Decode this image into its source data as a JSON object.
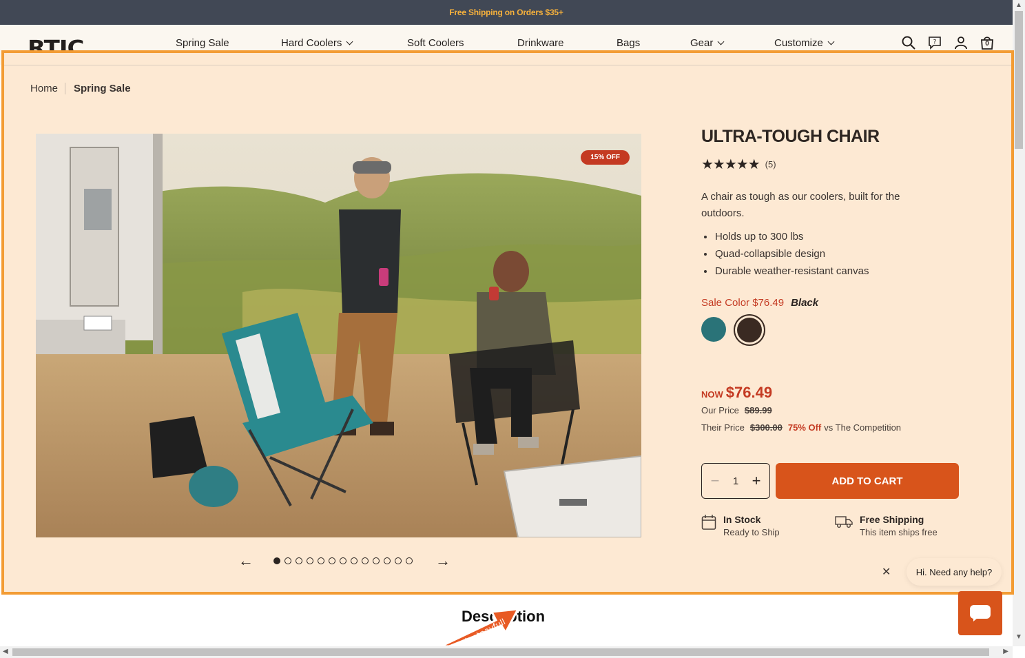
{
  "promo": {
    "text": "Free Shipping on Orders $35+"
  },
  "header": {
    "logo": "RTIC",
    "nav": [
      {
        "label": "Spring Sale",
        "dropdown": false
      },
      {
        "label": "Hard Coolers",
        "dropdown": true
      },
      {
        "label": "Soft Coolers",
        "dropdown": false
      },
      {
        "label": "Drinkware",
        "dropdown": false
      },
      {
        "label": "Bags",
        "dropdown": false
      },
      {
        "label": "Gear",
        "dropdown": true
      },
      {
        "label": "Customize",
        "dropdown": true
      }
    ],
    "icons": [
      "search-icon",
      "help-chat-icon",
      "account-icon",
      "cart-icon"
    ],
    "cart_count": "0"
  },
  "breadcrumb": {
    "home": "Home",
    "current": "Spring Sale"
  },
  "product": {
    "badge": "15% OFF",
    "title": "ULTRA-TOUGH CHAIR",
    "stars": "★★★★★",
    "rating_count": "(5)",
    "rating_value": 5,
    "description": "A chair as tough as our coolers, built for the outdoors.",
    "features": [
      "Holds up to 300 lbs",
      "Quad-collapsible design",
      "Durable weather-resistant canvas"
    ],
    "sale_color_label": "Sale Color $76.49",
    "selected_color": "Black",
    "swatches": [
      {
        "name": "Teal",
        "color": "#2a7378"
      },
      {
        "name": "Black",
        "color": "#3a2a22",
        "selected": true
      }
    ],
    "now_label": "NOW",
    "now_price": "$76.49",
    "our_price_label": "Our Price",
    "our_price": "$89.99",
    "their_price_label": "Their Price",
    "their_price": "$300.00",
    "pct_off": "75% Off",
    "competition_label": "vs The Competition",
    "quantity": "1",
    "add_to_cart": "ADD TO CART",
    "stock_title": "In Stock",
    "stock_sub": "Ready to Ship",
    "ship_title": "Free Shipping",
    "ship_sub": "This item ships free"
  },
  "carousel": {
    "total": 13,
    "active": 0
  },
  "chat": {
    "help_text": "Hi. Need any help?"
  },
  "section": {
    "title": "Description"
  },
  "watermark": "dontpayfull",
  "colors": {
    "accent": "#d8541b",
    "sale": "#c43a22",
    "panel": "#fde9d3",
    "frame": "#f39c34",
    "promo_bg": "#414855"
  }
}
